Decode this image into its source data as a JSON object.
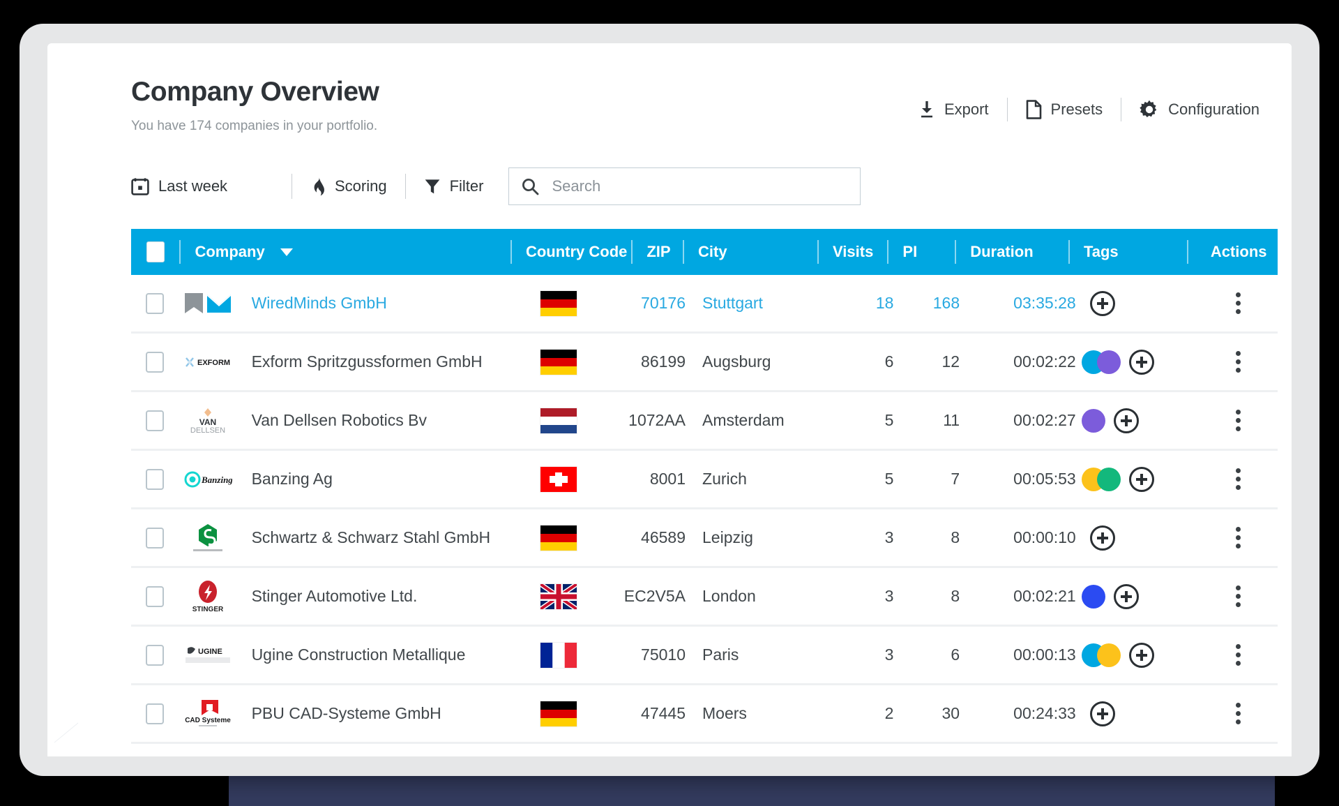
{
  "header": {
    "title": "Company Overview",
    "subtitle": "You have 174 companies in your portfolio.",
    "actions": [
      {
        "label": "Export",
        "icon": "download-icon"
      },
      {
        "label": "Presets",
        "icon": "document-icon"
      },
      {
        "label": "Configuration",
        "icon": "gear-icon"
      }
    ]
  },
  "filters": {
    "date_range": {
      "label": "Last week",
      "icon": "calendar-icon"
    },
    "scoring": {
      "label": "Scoring",
      "icon": "flame-icon"
    },
    "filter": {
      "label": "Filter",
      "icon": "funnel-icon"
    },
    "search": {
      "placeholder": "Search",
      "value": "",
      "icon": "search-icon"
    }
  },
  "table": {
    "columns": {
      "company": "Company",
      "country_code": "Country Code",
      "zip": "ZIP",
      "city": "City",
      "visits": "Visits",
      "pi": "PI",
      "duration": "Duration",
      "tags": "Tags",
      "actions": "Actions"
    },
    "sort": {
      "column": "Company",
      "direction": "desc"
    },
    "accent_color": "#00a7e1",
    "link_color": "#29a9e1",
    "rows": [
      {
        "company": "WiredMinds GmbH",
        "logo": "wiredminds-logo",
        "country": "de",
        "zip": "70176",
        "city": "Stuttgart",
        "visits": "18",
        "pi": "168",
        "duration": "03:35:28",
        "tags": [],
        "highlighted": true
      },
      {
        "company": "Exform Spritzgussformen GmbH",
        "logo": "exform-logo",
        "country": "de",
        "zip": "86199",
        "city": "Augsburg",
        "visits": "6",
        "pi": "12",
        "duration": "00:02:22",
        "tags": [
          "#00a7e1",
          "#7c5cdb"
        ],
        "highlighted": false
      },
      {
        "company": "Van Dellsen Robotics Bv",
        "logo": "vandellsen-logo",
        "country": "nl",
        "zip": "1072AA",
        "city": "Amsterdam",
        "visits": "5",
        "pi": "11",
        "duration": "00:02:27",
        "tags": [
          "#7c5cdb"
        ],
        "highlighted": false
      },
      {
        "company": "Banzing Ag",
        "logo": "banzing-logo",
        "country": "ch",
        "zip": "8001",
        "city": "Zurich",
        "visits": "5",
        "pi": "7",
        "duration": "00:05:53",
        "tags": [
          "#fcc21b",
          "#13b87c"
        ],
        "highlighted": false
      },
      {
        "company": "Schwartz & Schwarz Stahl GmbH",
        "logo": "schwartz-logo",
        "country": "de",
        "zip": "46589",
        "city": "Leipzig",
        "visits": "3",
        "pi": "8",
        "duration": "00:00:10",
        "tags": [],
        "highlighted": false
      },
      {
        "company": "Stinger Automotive Ltd.",
        "logo": "stinger-logo",
        "country": "gb",
        "zip": "EC2V5A",
        "city": "London",
        "visits": "3",
        "pi": "8",
        "duration": "00:02:21",
        "tags": [
          "#2b4bf2"
        ],
        "highlighted": false
      },
      {
        "company": "Ugine Construction Metallique",
        "logo": "ugine-logo",
        "country": "fr",
        "zip": "75010",
        "city": "Paris",
        "visits": "3",
        "pi": "6",
        "duration": "00:00:13",
        "tags": [
          "#00a7e1",
          "#fcc21b"
        ],
        "highlighted": false
      },
      {
        "company": "PBU CAD-Systeme GmbH",
        "logo": "pbucad-logo",
        "country": "de",
        "zip": "47445",
        "city": "Moers",
        "visits": "2",
        "pi": "30",
        "duration": "00:24:33",
        "tags": [],
        "highlighted": false
      }
    ]
  }
}
